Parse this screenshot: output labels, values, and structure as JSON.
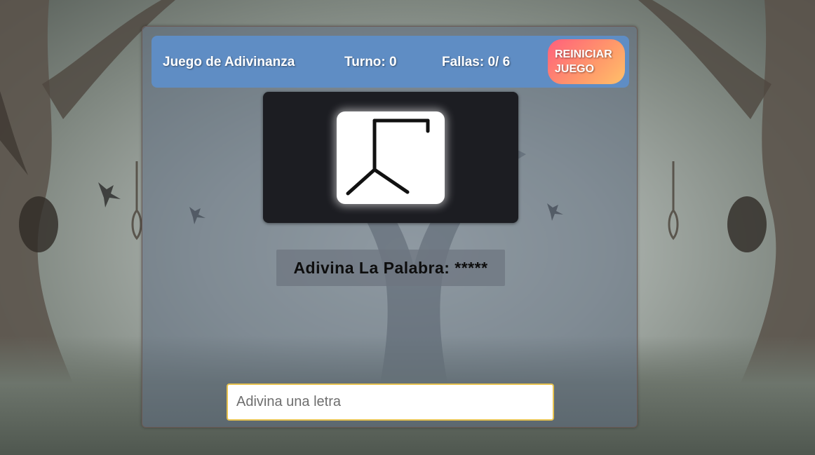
{
  "header": {
    "title": "Juego de Adivinanza",
    "turn_text": "Turno: 0",
    "fails_text": "Fallas: 0/ 6",
    "reset_button_label": "REINICIAR JUEGO"
  },
  "game": {
    "word_prompt": "Adivina La Palabra: *****",
    "input_placeholder": "Adivina una letra",
    "input_value": ""
  },
  "icons": {
    "gallows": "hangman-gallows-icon"
  },
  "colors": {
    "header_background": "#5f8dc4",
    "reset_button_gradient_start": "#ff5f7c",
    "reset_button_gradient_end": "#ffc06a",
    "stage_background": "#1c1d22",
    "input_border": "#e7c24f"
  }
}
